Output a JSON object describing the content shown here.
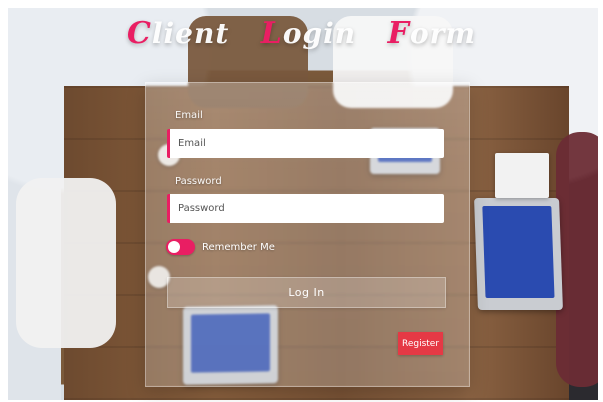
{
  "title": {
    "segments": [
      {
        "cap": "C",
        "rest": "lient"
      },
      {
        "cap": "L",
        "rest": "ogin"
      },
      {
        "cap": "F",
        "rest": "orm"
      }
    ]
  },
  "form": {
    "email_label": "Email",
    "email_placeholder": "Email",
    "password_label": "Password",
    "password_placeholder": "Password",
    "remember_label": "Remember Me",
    "remember_checked": true,
    "login_label": "Log In",
    "register_label": "Register"
  },
  "colors": {
    "accent": "#e91e63",
    "register": "#e53945"
  }
}
